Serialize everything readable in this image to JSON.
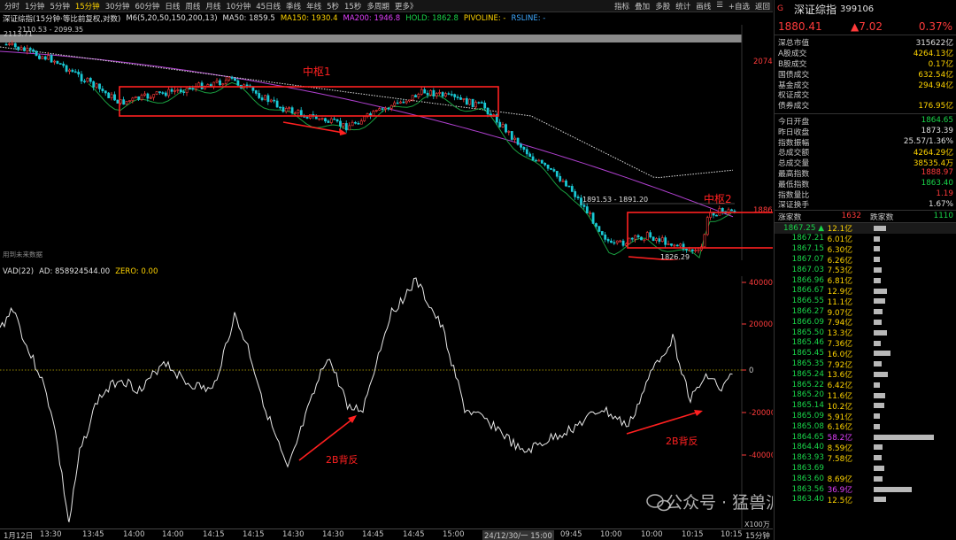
{
  "toolbar": {
    "periods": [
      "分时",
      "1分钟",
      "5分钟",
      "15分钟",
      "30分钟",
      "60分钟",
      "日线",
      "周线",
      "月线",
      "10分钟",
      "45日线",
      "季线",
      "年线",
      "5秒",
      "15秒",
      "多周期",
      "更多》"
    ],
    "active_period": "15分钟",
    "tools": [
      "指标",
      "叠加",
      "多股",
      "统计",
      "画线",
      "☰",
      "+自选",
      "返回"
    ]
  },
  "ma_line": {
    "title": "深证综指(15分钟·等比前复权,对数)",
    "m6": "M6(5,20,50,150,200,13)",
    "ma50": "MA50: 1859.5",
    "ma150": "MA150: 1930.4",
    "ma200": "MA200: 1946.8",
    "hold": "HOLD: 1862.8",
    "pivoline": "PIVOLINE: -",
    "rsline": "RSLINE: -"
  },
  "main_chart": {
    "labels": {
      "hi1": "2113.71",
      "hi2": "2110.53 - 2099.35",
      "zs1": "中枢1",
      "zs2": "中枢2",
      "mid": "1891.53 - 1891.20",
      "low": "1826.29",
      "future": "用到未来数据",
      "axis_2074": "2074",
      "axis_1886": "1886"
    }
  },
  "sub_header": {
    "vad": "VAD(22)",
    "ad": "AD: 858924544.00",
    "zero": "ZERO: 0.00"
  },
  "sub_chart": {
    "ticks": [
      "40000",
      "20000",
      "0",
      "-20000",
      "-40000"
    ],
    "unit": "X100万",
    "note1": "2B背反",
    "note2": "2B背反"
  },
  "time_axis": {
    "labels": [
      "1月12日",
      "13:30",
      "13:45",
      "14:00",
      "14:00",
      "14:15",
      "14:15",
      "14:30",
      "14:30",
      "14:45",
      "14:45",
      "15:00",
      "24/12/30/一 15:00",
      "09:45",
      "10:00",
      "10:00",
      "10:15",
      "10:15",
      "15分钟"
    ]
  },
  "watermark": "公众号 · 猛兽派选股",
  "panel": {
    "code_prefix": "G",
    "name": "深证综指",
    "code": "399106",
    "price": "1880.41",
    "change": "▲7.02",
    "pct": "0.37%",
    "stats": [
      {
        "k": "深总市值",
        "v": "315622亿",
        "c": "wh"
      },
      {
        "k": "A股成交",
        "v": "4264.13亿",
        "c": "yl"
      },
      {
        "k": "B股成交",
        "v": "0.17亿",
        "c": "yl"
      },
      {
        "k": "国债成交",
        "v": "632.54亿",
        "c": "yl"
      },
      {
        "k": "基金成交",
        "v": "294.94亿",
        "c": "yl"
      },
      {
        "k": "权证成交",
        "v": "",
        "c": "yl"
      },
      {
        "k": "债券成交",
        "v": "176.95亿",
        "c": "yl"
      }
    ],
    "stats2": [
      {
        "k": "今日开盘",
        "v": "1864.65",
        "c": "dn"
      },
      {
        "k": "昨日收盘",
        "v": "1873.39",
        "c": "wh"
      },
      {
        "k": "指数振幅",
        "v": "25.57/1.36%",
        "c": "wh"
      },
      {
        "k": "总成交额",
        "v": "4264.29亿",
        "c": "yl"
      },
      {
        "k": "总成交量",
        "v": "38535.4万",
        "c": "yl"
      },
      {
        "k": "最高指数",
        "v": "1888.97",
        "c": "up"
      },
      {
        "k": "最低指数",
        "v": "1863.40",
        "c": "dn"
      },
      {
        "k": "指数量比",
        "v": "1.19",
        "c": "up"
      },
      {
        "k": "深证换手",
        "v": "1.67%",
        "c": "wh"
      }
    ],
    "rise_label": "涨家数",
    "rise_val": "1632",
    "fall_label": "跌家数",
    "fall_val": "1110",
    "ticks": [
      {
        "p": "1867.25 ▲",
        "v": "12.1亿",
        "b": 14,
        "c": "yl"
      },
      {
        "p": "1867.21",
        "v": "6.01亿",
        "b": 7,
        "c": "yl"
      },
      {
        "p": "1867.15",
        "v": "6.30亿",
        "b": 7,
        "c": "yl"
      },
      {
        "p": "1867.07",
        "v": "6.26亿",
        "b": 7,
        "c": "yl"
      },
      {
        "p": "1867.03",
        "v": "7.53亿",
        "b": 9,
        "c": "yl"
      },
      {
        "p": "1866.96",
        "v": "6.81亿",
        "b": 8,
        "c": "yl"
      },
      {
        "p": "1866.67",
        "v": "12.9亿",
        "b": 15,
        "c": "yl"
      },
      {
        "p": "1866.55",
        "v": "11.1亿",
        "b": 13,
        "c": "yl"
      },
      {
        "p": "1866.27",
        "v": "9.07亿",
        "b": 10,
        "c": "yl"
      },
      {
        "p": "1866.09",
        "v": "7.94亿",
        "b": 9,
        "c": "yl"
      },
      {
        "p": "1865.50",
        "v": "13.3亿",
        "b": 15,
        "c": "yl"
      },
      {
        "p": "1865.46",
        "v": "7.36亿",
        "b": 8,
        "c": "yl"
      },
      {
        "p": "1865.45",
        "v": "16.0亿",
        "b": 19,
        "c": "yl"
      },
      {
        "p": "1865.35",
        "v": "7.92亿",
        "b": 9,
        "c": "yl"
      },
      {
        "p": "1865.24",
        "v": "13.6亿",
        "b": 16,
        "c": "yl"
      },
      {
        "p": "1865.22",
        "v": "6.42亿",
        "b": 7,
        "c": "yl"
      },
      {
        "p": "1865.20",
        "v": "11.6亿",
        "b": 13,
        "c": "yl"
      },
      {
        "p": "1865.14",
        "v": "10.2亿",
        "b": 12,
        "c": "yl"
      },
      {
        "p": "1865.09",
        "v": "5.91亿",
        "b": 7,
        "c": "yl"
      },
      {
        "p": "1865.08",
        "v": "6.16亿",
        "b": 7,
        "c": "yl"
      },
      {
        "p": "1864.65",
        "v": "58.2亿",
        "b": 68,
        "c": "mg"
      },
      {
        "p": "1864.40",
        "v": "8.59亿",
        "b": 10,
        "c": "yl"
      },
      {
        "p": "1863.93",
        "v": "7.58亿",
        "b": 9,
        "c": "yl"
      },
      {
        "p": "1863.69",
        "v": "",
        "b": 12,
        "c": "yl"
      },
      {
        "p": "1863.60",
        "v": "8.69亿",
        "b": 10,
        "c": "yl"
      },
      {
        "p": "1863.56",
        "v": "36.9亿",
        "b": 43,
        "c": "mg"
      },
      {
        "p": "1863.40",
        "v": "12.5亿",
        "b": 14,
        "c": "yl"
      }
    ]
  }
}
